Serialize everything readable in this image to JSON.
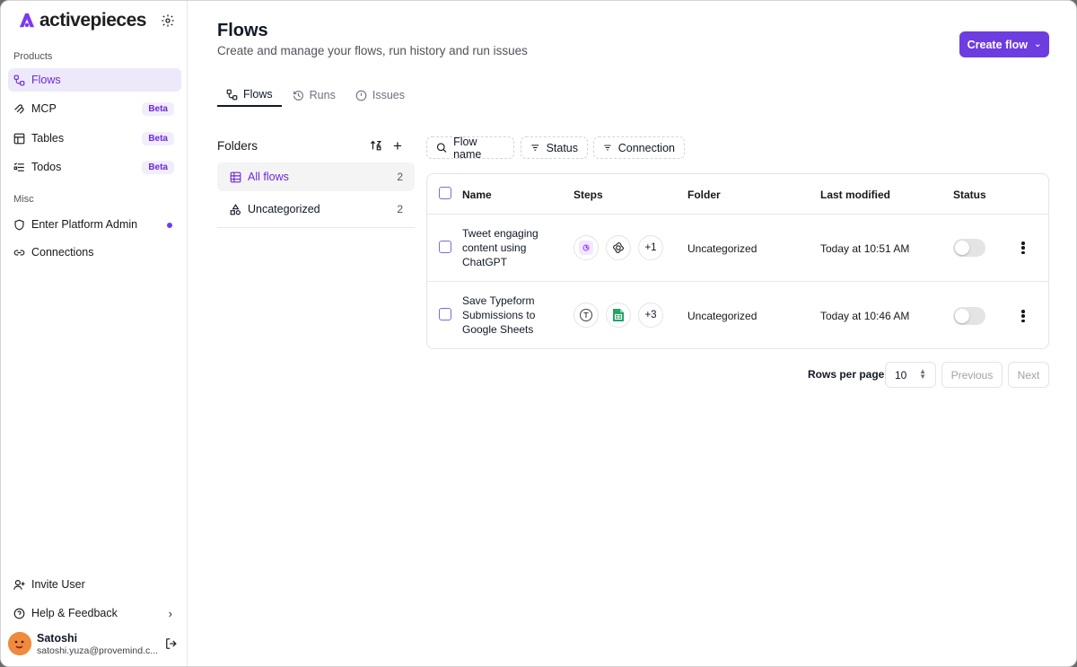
{
  "sidebar": {
    "logo_text": "activepieces",
    "products_label": "Products",
    "products": [
      {
        "label": "Flows",
        "icon": "flow-icon",
        "active": true
      },
      {
        "label": "MCP",
        "icon": "mcp-icon",
        "badge": "Beta"
      },
      {
        "label": "Tables",
        "icon": "table-icon",
        "badge": "Beta"
      },
      {
        "label": "Todos",
        "icon": "todo-list-icon",
        "badge": "Beta"
      }
    ],
    "misc_label": "Misc",
    "misc": [
      {
        "label": "Enter Platform Admin",
        "icon": "shield-icon"
      },
      {
        "label": "Connections",
        "icon": "link-icon"
      }
    ],
    "bottom": [
      {
        "label": "Invite User",
        "icon": "user-plus-icon"
      },
      {
        "label": "Help & Feedback",
        "icon": "help-circle-icon"
      }
    ],
    "user": {
      "name": "Satoshi",
      "email": "satoshi.yuza@provemind.c..."
    }
  },
  "header": {
    "title": "Flows",
    "subtitle": "Create and manage your flows, run history and run issues",
    "create_button": "Create flow"
  },
  "tabs": [
    {
      "label": "Flows",
      "icon": "flow-icon",
      "active": true
    },
    {
      "label": "Runs",
      "icon": "history-icon"
    },
    {
      "label": "Issues",
      "icon": "alert-circle-icon"
    }
  ],
  "folders": {
    "title": "Folders",
    "items": [
      {
        "label": "All flows",
        "count": "2",
        "icon": "table-icon",
        "active": true
      },
      {
        "label": "Uncategorized",
        "count": "2",
        "icon": "shapes-icon"
      }
    ]
  },
  "filters": [
    {
      "label": "Flow name",
      "icon": "search-icon"
    },
    {
      "label": "Status",
      "icon": "filter-icon"
    },
    {
      "label": "Connection",
      "icon": "filter-icon"
    }
  ],
  "table": {
    "columns": [
      "Name",
      "Steps",
      "Folder",
      "Last modified",
      "Status"
    ],
    "rows": [
      {
        "name": "Tweet engaging content using ChatGPT",
        "steps": [
          "webhook-icon",
          "openai-icon"
        ],
        "more_steps": "+1",
        "folder": "Uncategorized",
        "last_modified": "Today at 10:51 AM",
        "enabled": false
      },
      {
        "name": "Save Typeform Submissions to Google Sheets",
        "steps": [
          "typeform-icon",
          "google-sheets-icon"
        ],
        "more_steps": "+3",
        "folder": "Uncategorized",
        "last_modified": "Today at 10:46 AM",
        "enabled": false
      }
    ]
  },
  "pagination": {
    "rows_per_page_label": "Rows per page",
    "rows_per_page": "10",
    "previous": "Previous",
    "next": "Next"
  },
  "colors": {
    "accent": "#6d3de0",
    "active_bg": "#ede9fb",
    "border": "#e4e4e7"
  }
}
